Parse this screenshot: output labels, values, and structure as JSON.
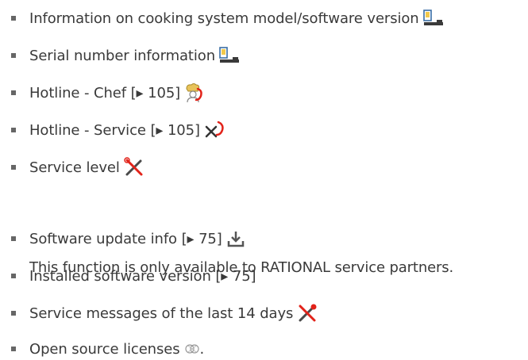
{
  "items": [
    {
      "label": "Information on cooking system model/software version",
      "icon": "cooking-system-icon"
    },
    {
      "label": "Serial number information",
      "icon": "cooking-system-icon"
    },
    {
      "label": "Hotline - Chef [▸ 105]",
      "icon": "chef-phone-icon"
    },
    {
      "label": "Hotline - Service [▸ 105]",
      "icon": "service-phone-icon"
    },
    {
      "label": "Service level",
      "icon": "tools-icon"
    },
    {
      "label": "Software update info [▸ 75]",
      "icon": "download-icon"
    },
    {
      "label": "Installed software version [▸ 75]",
      "icon": ""
    },
    {
      "label": "Service messages of the last 14 days",
      "icon": "tools-alert-icon"
    },
    {
      "label": "Open source licenses",
      "icon": "license-icon",
      "suffix": "."
    }
  ],
  "note": "This function is only available to RATIONAL service partners.",
  "colors": {
    "text": "#3a3a3a",
    "red": "#e2231a",
    "gold": "#e8c35a"
  }
}
